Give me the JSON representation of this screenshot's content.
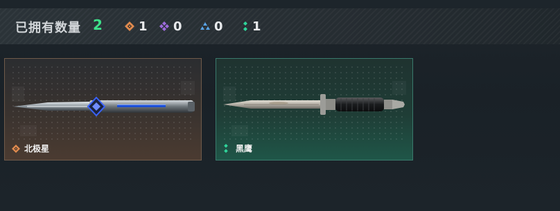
{
  "header": {
    "owned_label": "已拥有数量",
    "owned_count": "2",
    "rarity_counts": [
      {
        "icon": "orange-diamond-icon",
        "color": "#e08a4e",
        "count": "1"
      },
      {
        "icon": "purple-diamond-icon",
        "color": "#9d6bdc",
        "count": "0"
      },
      {
        "icon": "blue-triangle-icon",
        "color": "#5aa4e6",
        "count": "0"
      },
      {
        "icon": "green-dots-icon",
        "color": "#2fd49a",
        "count": "1"
      }
    ]
  },
  "items": [
    {
      "name": "北极星",
      "rarity_icon": "orange-diamond-icon",
      "rarity_color": "#e08a4e"
    },
    {
      "name": "黑鹰",
      "rarity_icon": "green-dots-icon",
      "rarity_color": "#2fd49a"
    }
  ]
}
